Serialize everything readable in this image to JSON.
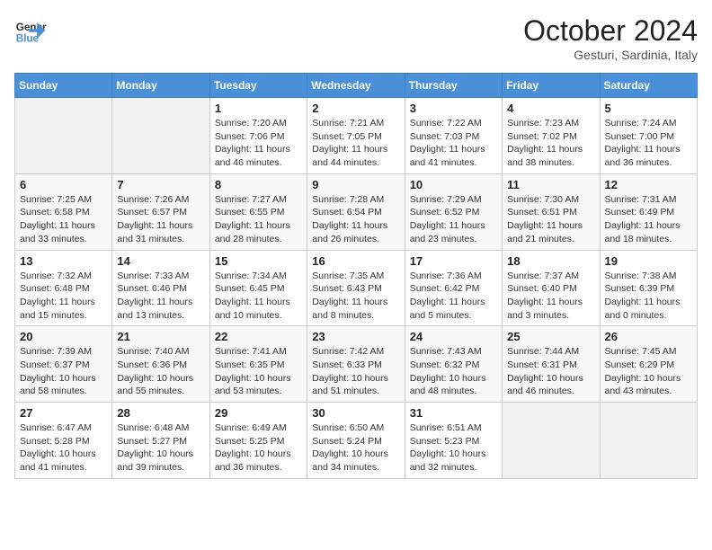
{
  "header": {
    "logo_line1": "General",
    "logo_line2": "Blue",
    "month": "October 2024",
    "location": "Gesturi, Sardinia, Italy"
  },
  "weekdays": [
    "Sunday",
    "Monday",
    "Tuesday",
    "Wednesday",
    "Thursday",
    "Friday",
    "Saturday"
  ],
  "weeks": [
    [
      {
        "day": "",
        "empty": true
      },
      {
        "day": "",
        "empty": true
      },
      {
        "day": "1",
        "sunrise": "7:20 AM",
        "sunset": "7:06 PM",
        "daylight": "11 hours and 46 minutes."
      },
      {
        "day": "2",
        "sunrise": "7:21 AM",
        "sunset": "7:05 PM",
        "daylight": "11 hours and 44 minutes."
      },
      {
        "day": "3",
        "sunrise": "7:22 AM",
        "sunset": "7:03 PM",
        "daylight": "11 hours and 41 minutes."
      },
      {
        "day": "4",
        "sunrise": "7:23 AM",
        "sunset": "7:02 PM",
        "daylight": "11 hours and 38 minutes."
      },
      {
        "day": "5",
        "sunrise": "7:24 AM",
        "sunset": "7:00 PM",
        "daylight": "11 hours and 36 minutes."
      }
    ],
    [
      {
        "day": "6",
        "sunrise": "7:25 AM",
        "sunset": "6:58 PM",
        "daylight": "11 hours and 33 minutes."
      },
      {
        "day": "7",
        "sunrise": "7:26 AM",
        "sunset": "6:57 PM",
        "daylight": "11 hours and 31 minutes."
      },
      {
        "day": "8",
        "sunrise": "7:27 AM",
        "sunset": "6:55 PM",
        "daylight": "11 hours and 28 minutes."
      },
      {
        "day": "9",
        "sunrise": "7:28 AM",
        "sunset": "6:54 PM",
        "daylight": "11 hours and 26 minutes."
      },
      {
        "day": "10",
        "sunrise": "7:29 AM",
        "sunset": "6:52 PM",
        "daylight": "11 hours and 23 minutes."
      },
      {
        "day": "11",
        "sunrise": "7:30 AM",
        "sunset": "6:51 PM",
        "daylight": "11 hours and 21 minutes."
      },
      {
        "day": "12",
        "sunrise": "7:31 AM",
        "sunset": "6:49 PM",
        "daylight": "11 hours and 18 minutes."
      }
    ],
    [
      {
        "day": "13",
        "sunrise": "7:32 AM",
        "sunset": "6:48 PM",
        "daylight": "11 hours and 15 minutes."
      },
      {
        "day": "14",
        "sunrise": "7:33 AM",
        "sunset": "6:46 PM",
        "daylight": "11 hours and 13 minutes."
      },
      {
        "day": "15",
        "sunrise": "7:34 AM",
        "sunset": "6:45 PM",
        "daylight": "11 hours and 10 minutes."
      },
      {
        "day": "16",
        "sunrise": "7:35 AM",
        "sunset": "6:43 PM",
        "daylight": "11 hours and 8 minutes."
      },
      {
        "day": "17",
        "sunrise": "7:36 AM",
        "sunset": "6:42 PM",
        "daylight": "11 hours and 5 minutes."
      },
      {
        "day": "18",
        "sunrise": "7:37 AM",
        "sunset": "6:40 PM",
        "daylight": "11 hours and 3 minutes."
      },
      {
        "day": "19",
        "sunrise": "7:38 AM",
        "sunset": "6:39 PM",
        "daylight": "11 hours and 0 minutes."
      }
    ],
    [
      {
        "day": "20",
        "sunrise": "7:39 AM",
        "sunset": "6:37 PM",
        "daylight": "10 hours and 58 minutes."
      },
      {
        "day": "21",
        "sunrise": "7:40 AM",
        "sunset": "6:36 PM",
        "daylight": "10 hours and 55 minutes."
      },
      {
        "day": "22",
        "sunrise": "7:41 AM",
        "sunset": "6:35 PM",
        "daylight": "10 hours and 53 minutes."
      },
      {
        "day": "23",
        "sunrise": "7:42 AM",
        "sunset": "6:33 PM",
        "daylight": "10 hours and 51 minutes."
      },
      {
        "day": "24",
        "sunrise": "7:43 AM",
        "sunset": "6:32 PM",
        "daylight": "10 hours and 48 minutes."
      },
      {
        "day": "25",
        "sunrise": "7:44 AM",
        "sunset": "6:31 PM",
        "daylight": "10 hours and 46 minutes."
      },
      {
        "day": "26",
        "sunrise": "7:45 AM",
        "sunset": "6:29 PM",
        "daylight": "10 hours and 43 minutes."
      }
    ],
    [
      {
        "day": "27",
        "sunrise": "6:47 AM",
        "sunset": "5:28 PM",
        "daylight": "10 hours and 41 minutes."
      },
      {
        "day": "28",
        "sunrise": "6:48 AM",
        "sunset": "5:27 PM",
        "daylight": "10 hours and 39 minutes."
      },
      {
        "day": "29",
        "sunrise": "6:49 AM",
        "sunset": "5:25 PM",
        "daylight": "10 hours and 36 minutes."
      },
      {
        "day": "30",
        "sunrise": "6:50 AM",
        "sunset": "5:24 PM",
        "daylight": "10 hours and 34 minutes."
      },
      {
        "day": "31",
        "sunrise": "6:51 AM",
        "sunset": "5:23 PM",
        "daylight": "10 hours and 32 minutes."
      },
      {
        "day": "",
        "empty": true
      },
      {
        "day": "",
        "empty": true
      }
    ]
  ]
}
